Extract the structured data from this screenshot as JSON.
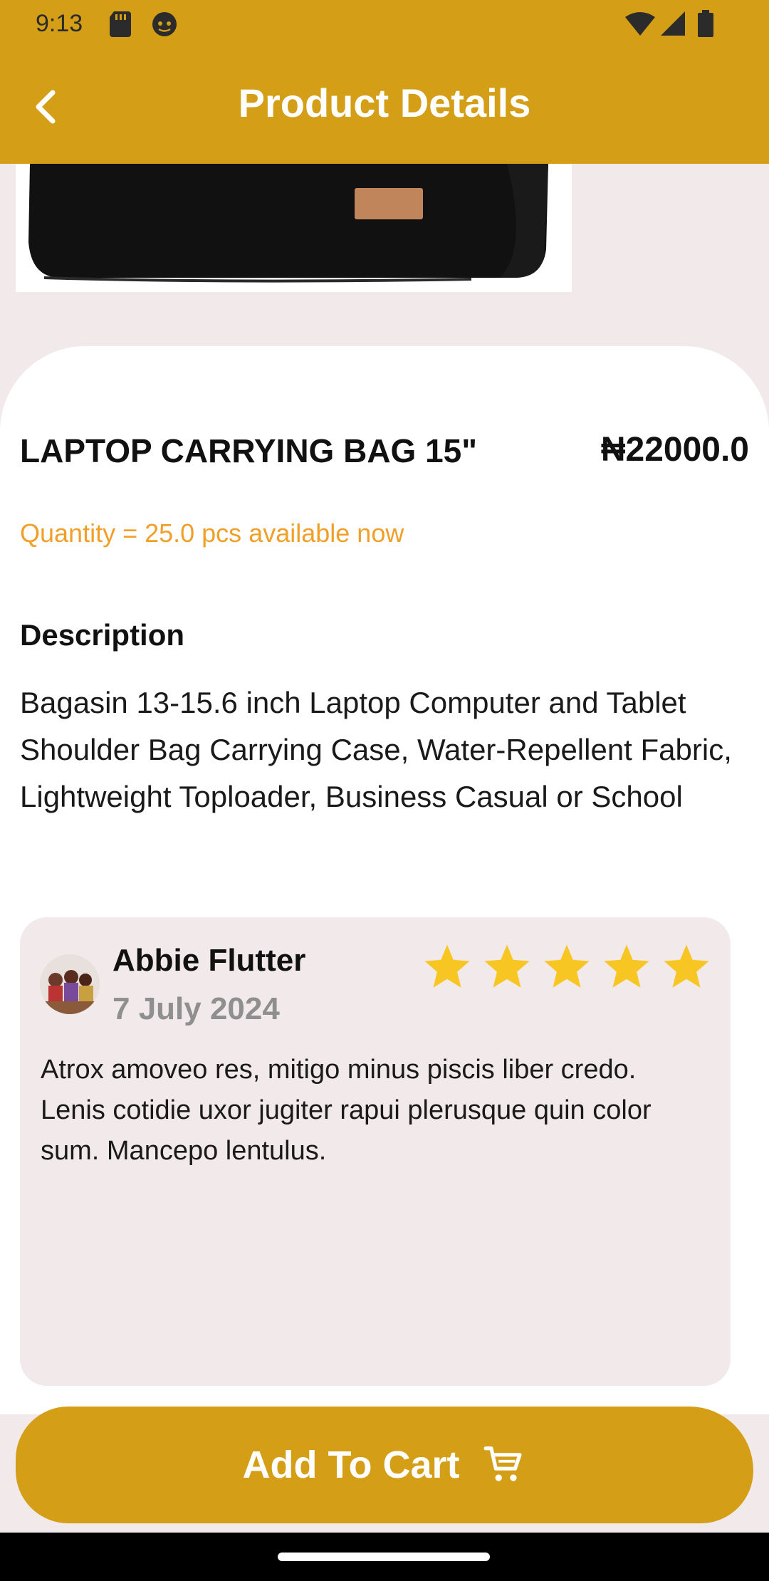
{
  "status_bar": {
    "time": "9:13"
  },
  "header": {
    "title": "Product Details"
  },
  "product": {
    "name": "LAPTOP CARRYING BAG 15\"",
    "price": "₦22000.0",
    "quantity_text": "Quantity = 25.0 pcs available now"
  },
  "description": {
    "heading": "Description",
    "text": "Bagasin 13-15.6 inch Laptop Computer and Tablet Shoulder Bag Carrying Case, Water-Repellent Fabric, Lightweight Toploader, Business Casual or School"
  },
  "review": {
    "name": "Abbie Flutter",
    "date": "7 July 2024",
    "rating": 5,
    "max_rating": 5,
    "text": "Atrox amoveo res, mitigo minus piscis liber credo. Lenis cotidie uxor jugiter rapui plerusque quin color sum. Mancepo lentulus."
  },
  "actions": {
    "add_to_cart": "Add To Cart"
  },
  "colors": {
    "primary": "#d49e17",
    "star": "#f8c623",
    "quantity": "#f0a028"
  }
}
